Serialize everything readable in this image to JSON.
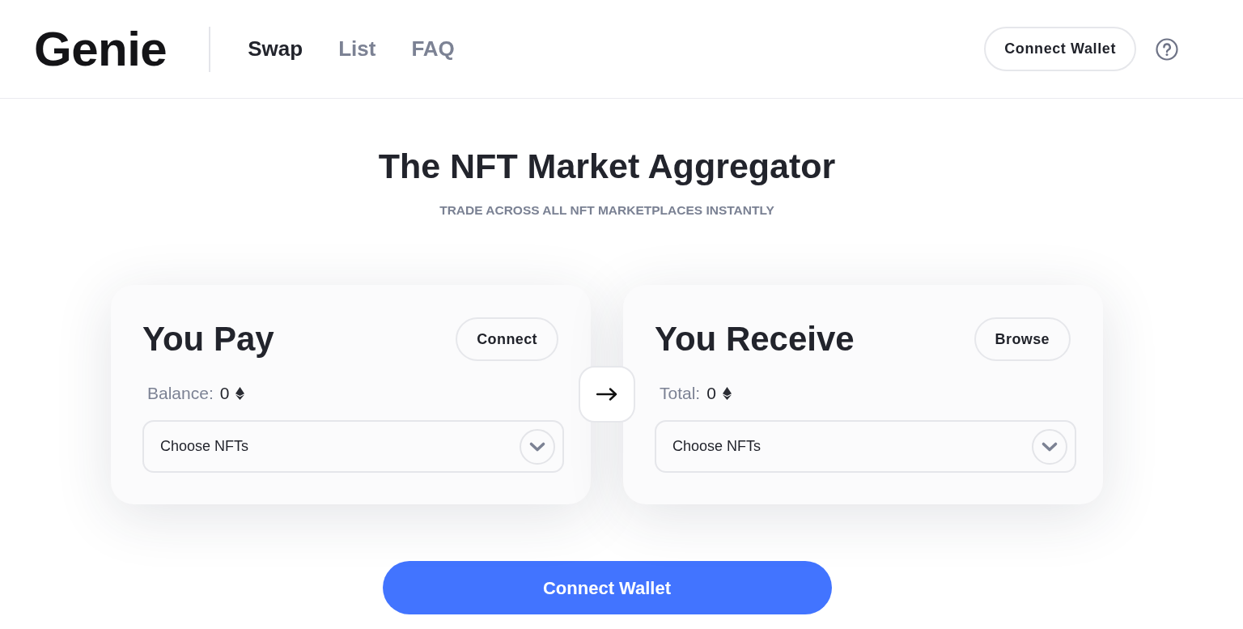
{
  "header": {
    "logo": "Genie",
    "nav": [
      {
        "label": "Swap",
        "selected": true
      },
      {
        "label": "List",
        "selected": false
      },
      {
        "label": "FAQ",
        "selected": false
      }
    ],
    "connect_button": "Connect Wallet"
  },
  "hero": {
    "title": "The NFT Market Aggregator",
    "subtitle": "TRADE ACROSS ALL NFT MARKETPLACES INSTANTLY"
  },
  "panels": [
    {
      "title": "You Pay",
      "button": "Connect",
      "amount_label": "Balance:",
      "amount": "0",
      "dropdown": "Choose NFTs"
    },
    {
      "title": "You Receive",
      "button": "Browse",
      "amount_label": "Total:",
      "amount": "0",
      "dropdown": "Choose NFTs"
    }
  ],
  "primary_button": "Connect Wallet"
}
